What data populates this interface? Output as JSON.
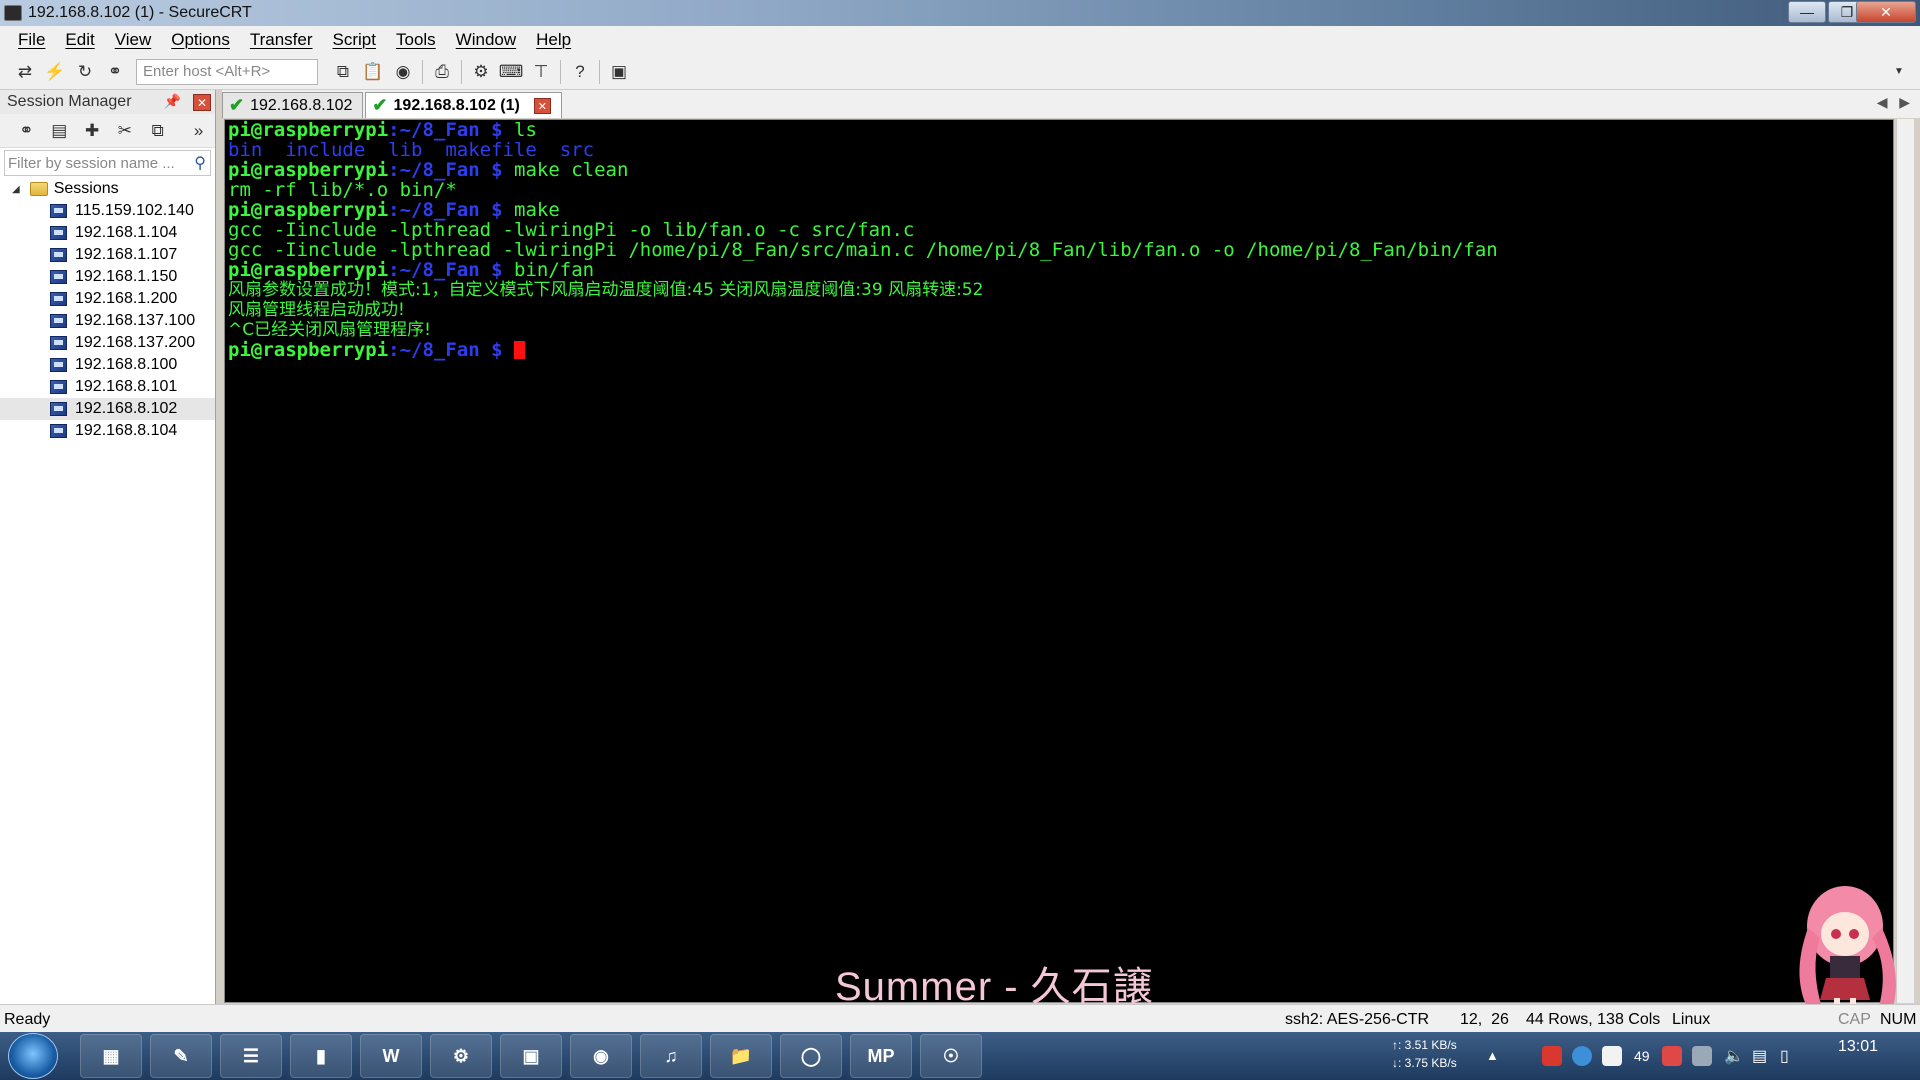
{
  "window": {
    "title": "192.168.8.102 (1) - SecureCRT"
  },
  "menu": [
    "File",
    "Edit",
    "View",
    "Options",
    "Transfer",
    "Script",
    "Tools",
    "Window",
    "Help"
  ],
  "toolbar": {
    "host_placeholder": "Enter host <Alt+R>"
  },
  "session_manager": {
    "title": "Session Manager",
    "filter_placeholder": "Filter by session name ...",
    "root": "Sessions",
    "items": [
      "115.159.102.140",
      "192.168.1.104",
      "192.168.1.107",
      "192.168.1.150",
      "192.168.1.200",
      "192.168.137.100",
      "192.168.137.200",
      "192.168.8.100",
      "192.168.8.101",
      "192.168.8.102",
      "192.168.8.104"
    ],
    "selected": "192.168.8.102"
  },
  "tabs": [
    {
      "label": "192.168.8.102"
    },
    {
      "label": "192.168.8.102 (1)"
    }
  ],
  "terminal": {
    "prompt_user": "pi@raspberrypi",
    "prompt_path": ":~/8_Fan $ ",
    "cmd1": "ls",
    "ls_output": "bin  include  lib  makefile  src",
    "cmd2": "make clean",
    "out2": "rm -rf lib/*.o bin/*",
    "cmd3": "make",
    "out3a": "gcc -Iinclude -lpthread -lwiringPi -o lib/fan.o -c src/fan.c",
    "out3b": "gcc -Iinclude -lpthread -lwiringPi /home/pi/8_Fan/src/main.c /home/pi/8_Fan/lib/fan.o -o /home/pi/8_Fan/bin/fan",
    "cmd4": "bin/fan",
    "out4a": "风扇参数设置成功！模式:1，自定义模式下风扇启动温度阈值:45 关闭风扇温度阈值:39 风扇转速:52",
    "out4b": "风扇管理线程启动成功!",
    "out4c": "^C已经关闭风扇管理程序!"
  },
  "watermark": "Summer - 久石譲",
  "status": {
    "ready": "Ready",
    "cipher": "ssh2: AES-256-CTR",
    "cursor_pos": "12,  26",
    "size": "44 Rows, 138 Cols",
    "os": "Linux",
    "caps": "CAP",
    "num": "NUM"
  },
  "taskbar": {
    "upload": "↑: 3.51 KB/s",
    "download": "↓: 3.75 KB/s",
    "tray_num": "49",
    "clock": "13:01",
    "app_mp": "MP"
  },
  "colors": {
    "prompt": "#3cf53c",
    "path": "#2d3df0",
    "cursor": "#ff1010"
  }
}
